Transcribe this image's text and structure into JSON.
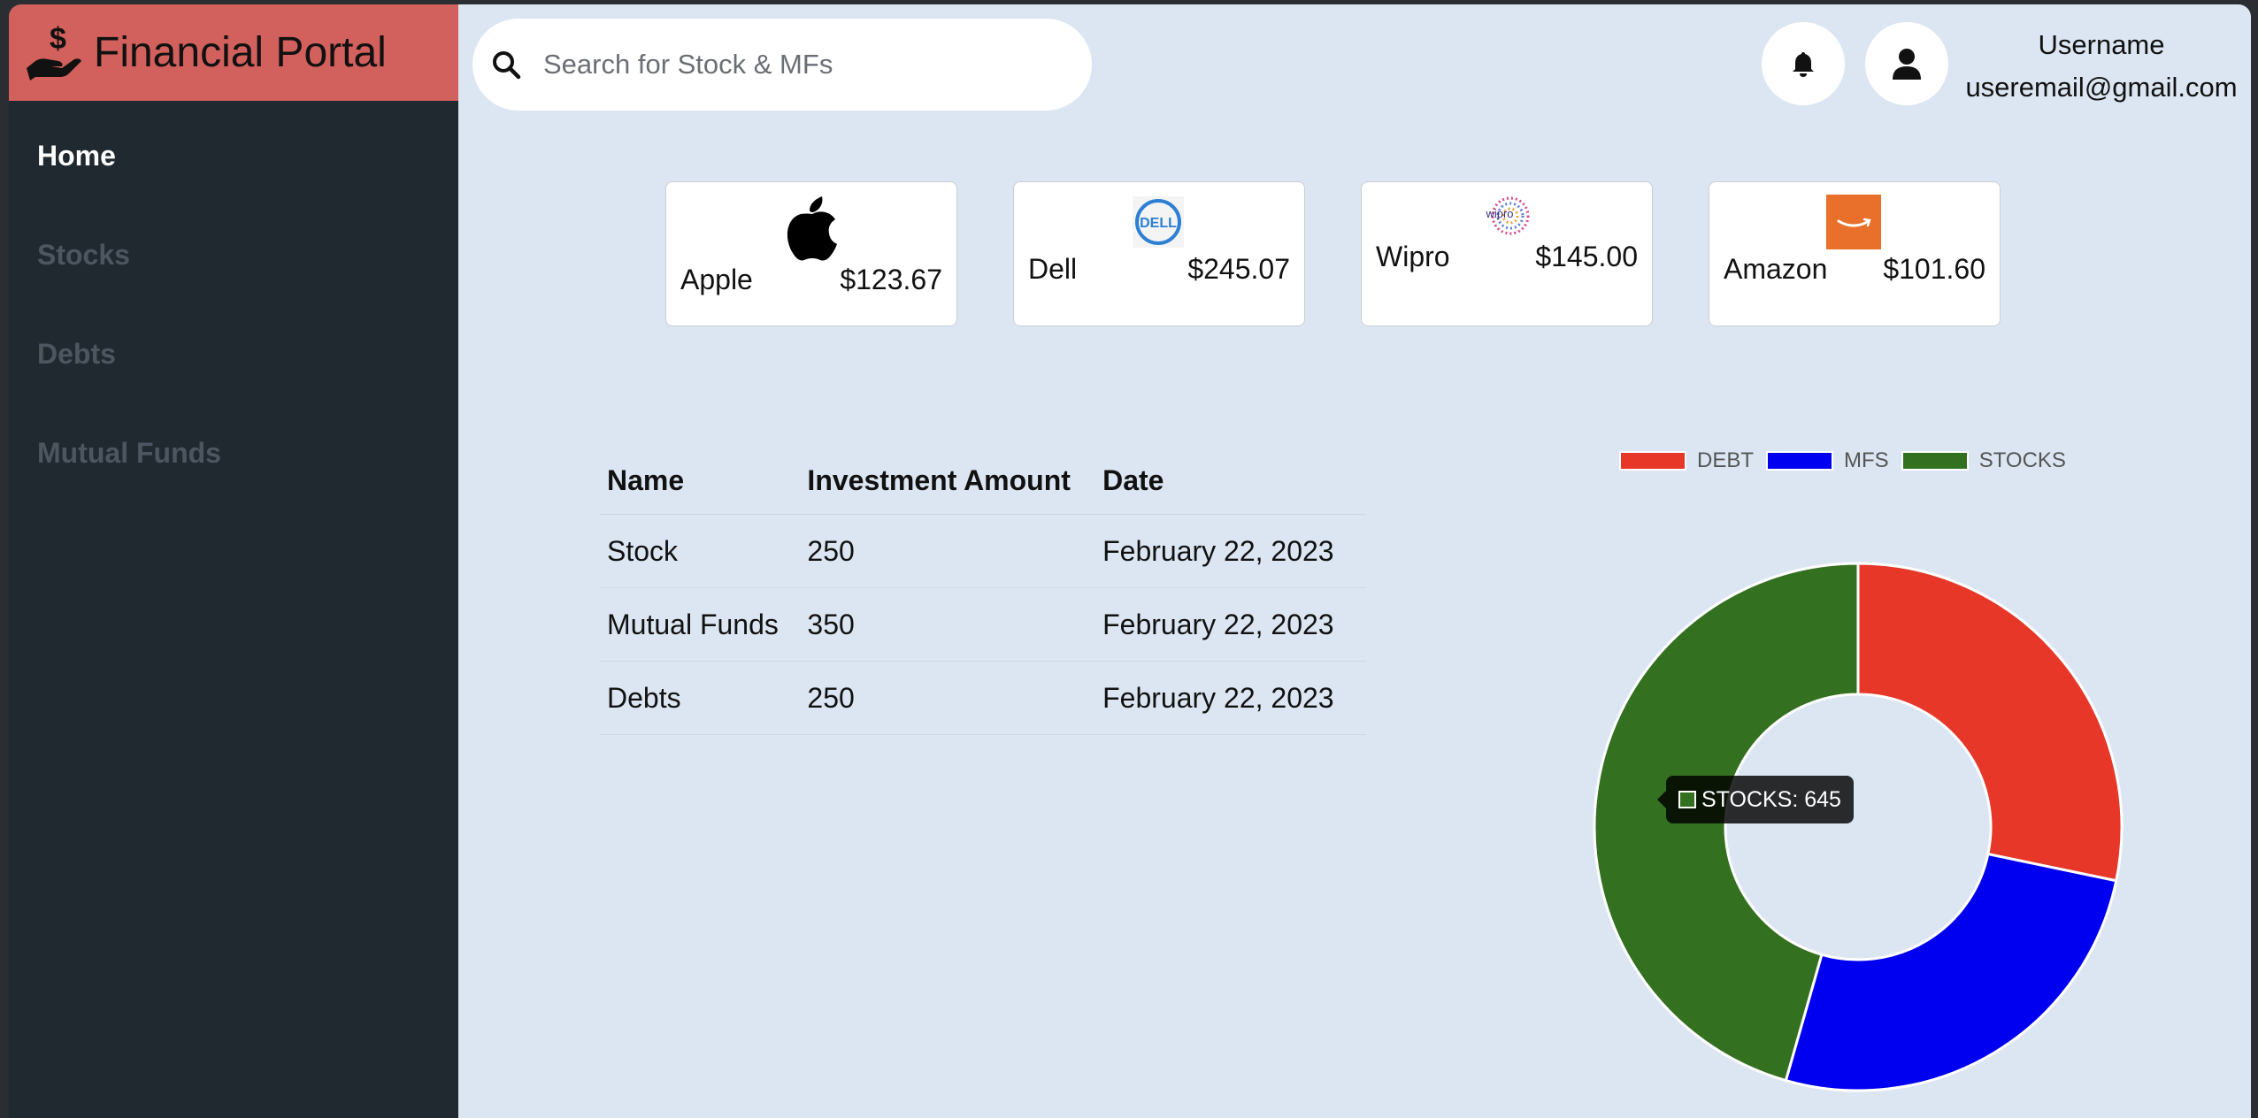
{
  "app": {
    "title": "Financial Portal"
  },
  "sidebar": {
    "items": [
      {
        "label": "Home",
        "active": true
      },
      {
        "label": "Stocks",
        "active": false
      },
      {
        "label": "Debts",
        "active": false
      },
      {
        "label": "Mutual Funds",
        "active": false
      }
    ]
  },
  "search": {
    "placeholder": "Search for Stock & MFs",
    "value": ""
  },
  "header": {
    "notification_icon": "bell-icon",
    "avatar_icon": "user-icon",
    "username": "Username",
    "email": "useremail@gmail.com"
  },
  "stocks": [
    {
      "name": "Apple",
      "price": "$123.67",
      "logo": "apple-logo"
    },
    {
      "name": "Dell",
      "price": "$245.07",
      "logo": "dell-logo"
    },
    {
      "name": "Wipro",
      "price": "$145.00",
      "logo": "wipro-logo"
    },
    {
      "name": "Amazon",
      "price": "$101.60",
      "logo": "amazon-logo"
    }
  ],
  "investments": {
    "headers": [
      "Name",
      "Investment Amount",
      "Date"
    ],
    "rows": [
      [
        "Stock",
        "250",
        "February 22, 2023"
      ],
      [
        "Mutual Funds",
        "350",
        "February 22, 2023"
      ],
      [
        "Debts",
        "250",
        "February 22, 2023"
      ]
    ]
  },
  "chart_data": {
    "type": "pie",
    "variant": "doughnut",
    "categories": [
      "DEBT",
      "MFS",
      "STOCKS"
    ],
    "values": [
      400,
      370,
      645
    ],
    "colors": [
      "#e73728",
      "#0000f0",
      "#33701f"
    ],
    "legend_position": "top",
    "tooltip": {
      "label": "STOCKS: 645",
      "color": "#33701f"
    }
  },
  "colors": {
    "brand": "#d2605c",
    "sidebar": "#212930",
    "background": "#dce6f2"
  }
}
